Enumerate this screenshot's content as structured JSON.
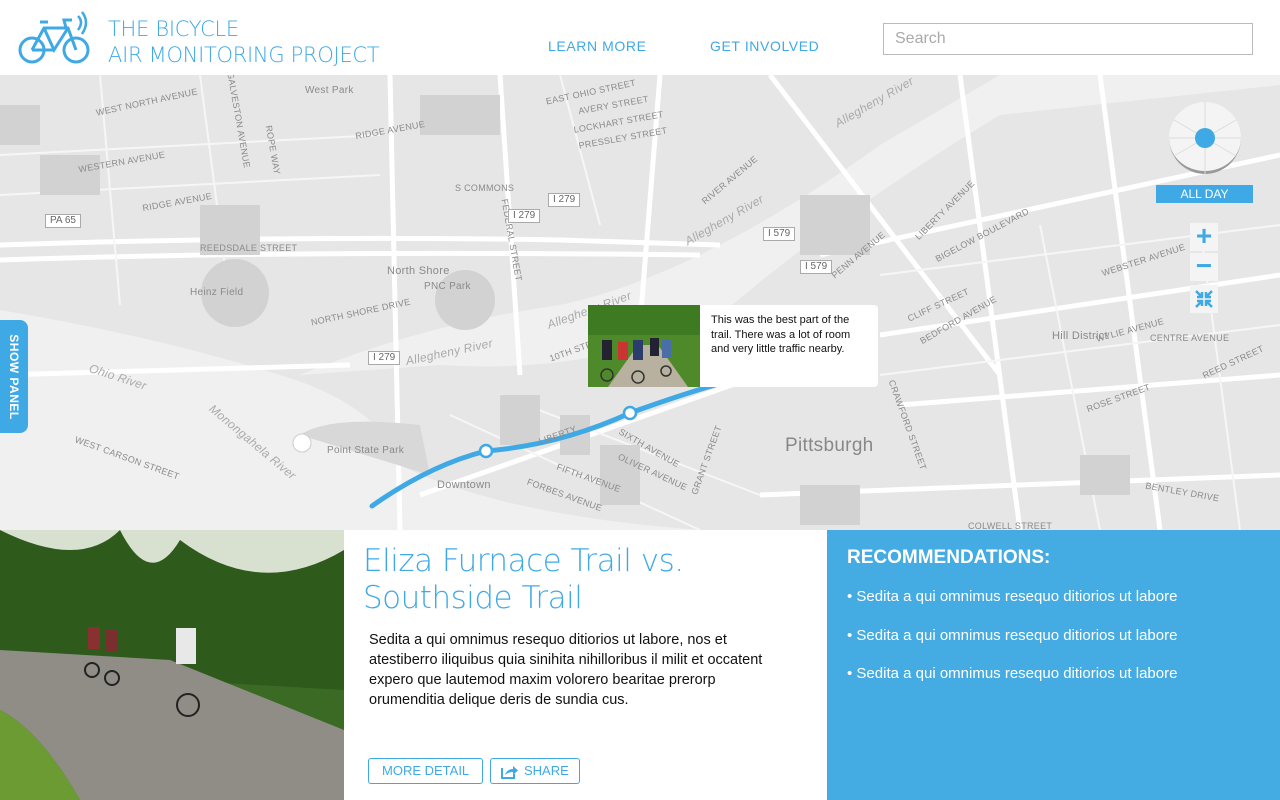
{
  "header": {
    "logo_line1": "THE BICYCLE",
    "logo_line2": "AIR MONITORING PROJECT",
    "nav": [
      {
        "label": "LEARN MORE"
      },
      {
        "label": "GET INVOLVED"
      }
    ],
    "search_placeholder": "Search",
    "search_value": ""
  },
  "map": {
    "streets": [
      "WEST NORTH AVENUE",
      "RIDGE AVENUE",
      "WESTERN AVENUE",
      "RIDGE AVENUE",
      "REEDSDALE STREET",
      "NORTH SHORE DRIVE",
      "S COMMONS",
      "FEDERAL STREET",
      "EAST OHIO STREET",
      "AVERY STREET",
      "LOCKHART STREET",
      "PRESSLEY STREET",
      "RIVER AVENUE",
      "PENN AVENUE",
      "LIBERTY AVENUE",
      "BIGELOW BOULEVARD",
      "WEBSTER AVENUE",
      "WYLIE AVENUE",
      "CENTRE AVENUE",
      "FIFTH AVENUE",
      "FORBES AVENUE",
      "SIXTH AVENUE",
      "GRANT STREET",
      "10TH STREET",
      "WEST CARSON STREET",
      "CRAWFORD STREET",
      "BEDFORD AVENUE",
      "ROSE STREET",
      "BENTLEY DRIVE",
      "COLWELL STREET",
      "REED STREET",
      "CLIFF STREET",
      "GALVESTON AVENUE",
      "ROPE WAY",
      "LIBERTY",
      "OLIVER AVENUE"
    ],
    "rivers": [
      "Allegheny River",
      "Allegheny River",
      "Allegheny River",
      "Allegheny River",
      "Ohio River",
      "Monongahela River"
    ],
    "places": [
      "West Park",
      "North Shore",
      "PNC Park",
      "Heinz Field",
      "Point State Park",
      "Downtown",
      "Hill District"
    ],
    "city": "Pittsburgh",
    "highways": [
      "PA 65",
      "I 279",
      "I 279",
      "I 279",
      "I 579",
      "I 579"
    ],
    "show_panel_label": "SHOW PANEL",
    "time_filter": "ALL DAY",
    "route_color": "#3fa9e6",
    "popup": {
      "text": "This was the best part of the trail. There was a lot of room and very little traffic nearby."
    }
  },
  "article": {
    "title": "Eliza Furnace Trail vs. Southside Trail",
    "body": "Sedita a qui omnimus resequo ditiorios ut labore, nos et atestiberro iliquibus quia sinihita nihilloribus il milit et occatent expero que lautemod maxim volorero bearitae prerorp orumenditia delique deris de sundia cus.",
    "more_detail": "MORE DETAIL",
    "share": "SHARE"
  },
  "recommendations": {
    "title": "RECOMMENDATIONS:",
    "items": [
      "• Sedita a qui omnimus resequo ditiorios ut labore",
      "• Sedita a qui omnimus resequo ditiorios ut labore",
      "• Sedita a qui omnimus resequo ditiorios ut labore"
    ]
  },
  "colors": {
    "accent": "#3fa9e6",
    "recs_bg": "#45ace3",
    "map_bg": "#e6e6e6"
  }
}
